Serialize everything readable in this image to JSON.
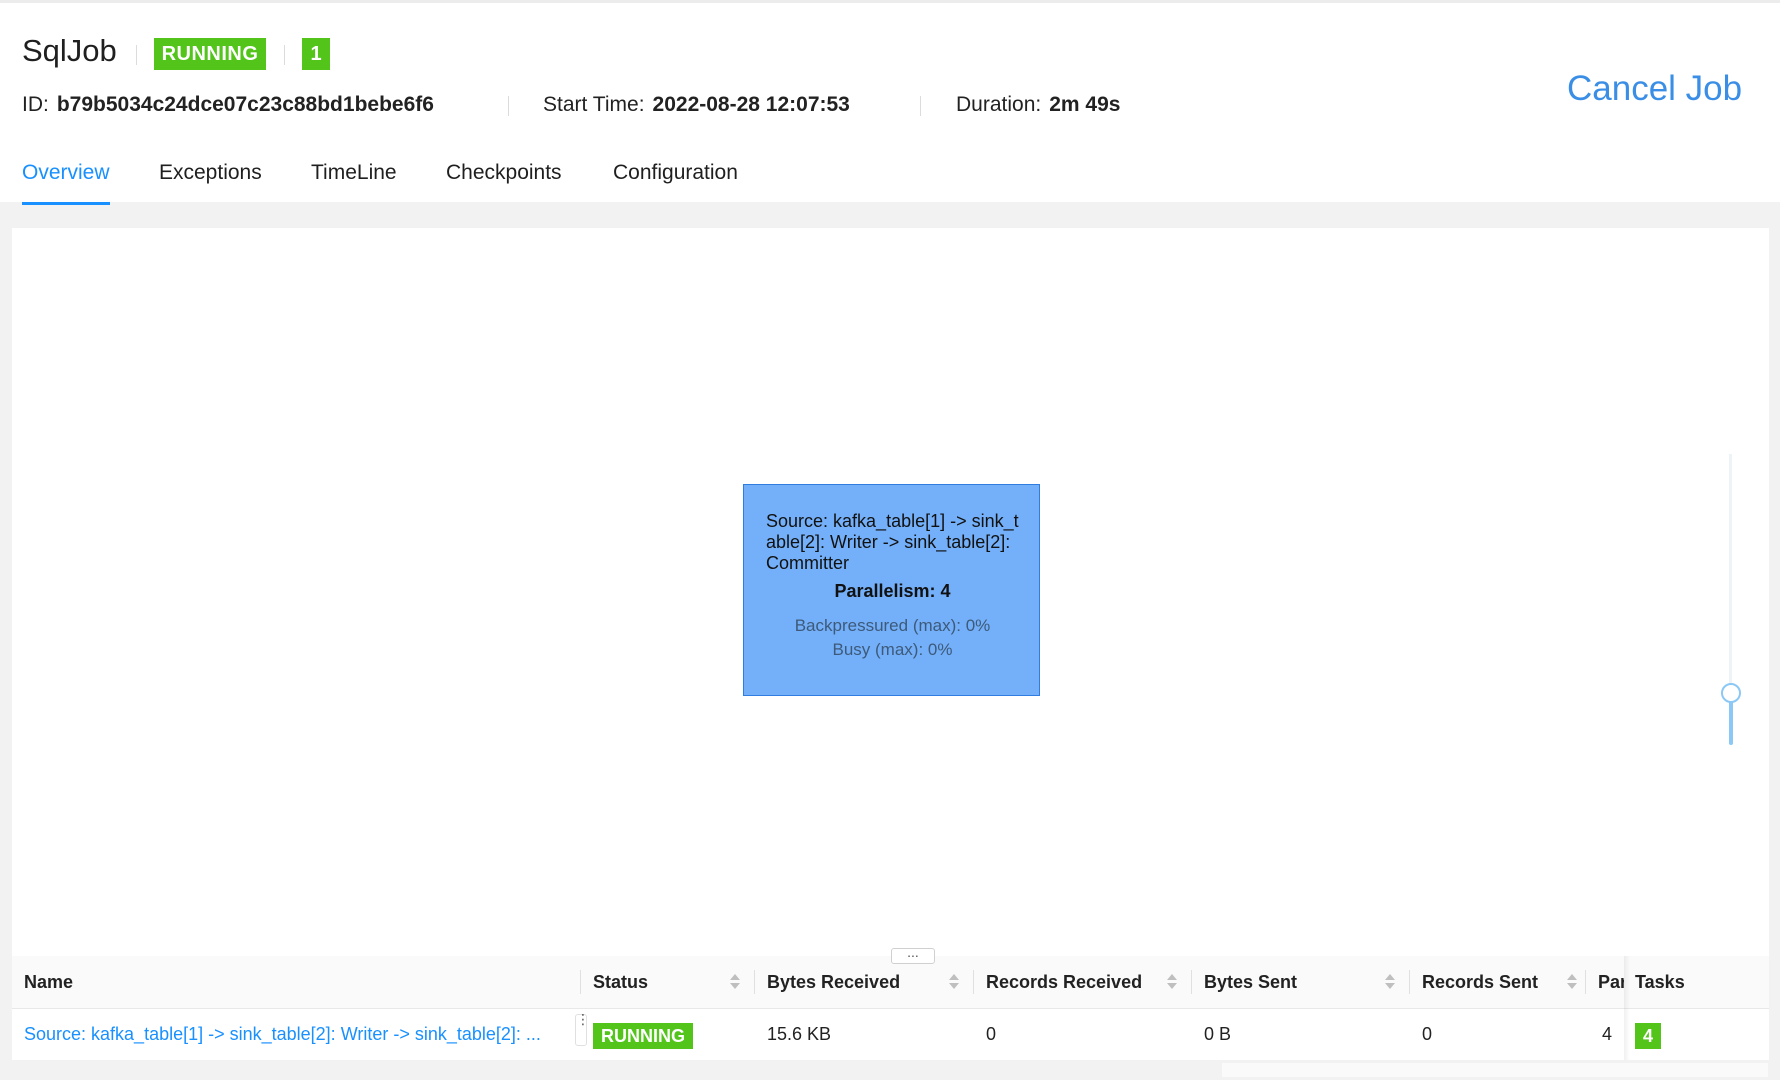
{
  "job": {
    "name": "SqlJob",
    "status": "RUNNING",
    "count": "1",
    "id_label": "ID:",
    "id_value": "b79b5034c24dce07c23c88bd1bebe6f6",
    "start_label": "Start Time:",
    "start_value": "2022-08-28 12:07:53",
    "duration_label": "Duration:",
    "duration_value": "2m 49s",
    "cancel_label": "Cancel Job"
  },
  "tabs": [
    {
      "label": "Overview",
      "active": true
    },
    {
      "label": "Exceptions",
      "active": false
    },
    {
      "label": "TimeLine",
      "active": false
    },
    {
      "label": "Checkpoints",
      "active": false
    },
    {
      "label": "Configuration",
      "active": false
    }
  ],
  "node": {
    "name": "Source: kafka_table[1] -> sink_table[2]: Writer -> sink_table[2]: Committer",
    "parallelism": "Parallelism: 4",
    "backpressured": "Backpressured (max): 0%",
    "busy": "Busy (max): 0%"
  },
  "zoom": {
    "level": 0.18
  },
  "grip_label": "...",
  "table": {
    "columns": [
      "Name",
      "Status",
      "Bytes Received",
      "Records Received",
      "Bytes Sent",
      "Records Sent",
      "Par",
      "Tasks"
    ],
    "rows": [
      {
        "name": "Source: kafka_table[1] -> sink_table[2]: Writer -> sink_table[2]: ...",
        "status": "RUNNING",
        "bytes_received": "15.6 KB",
        "records_received": "0",
        "bytes_sent": "0 B",
        "records_sent": "0",
        "parallelism": "4",
        "tasks": "4"
      }
    ]
  },
  "colors": {
    "accent": "#1890ff",
    "running": "#52c41a",
    "node_fill": "#74b0f9"
  }
}
